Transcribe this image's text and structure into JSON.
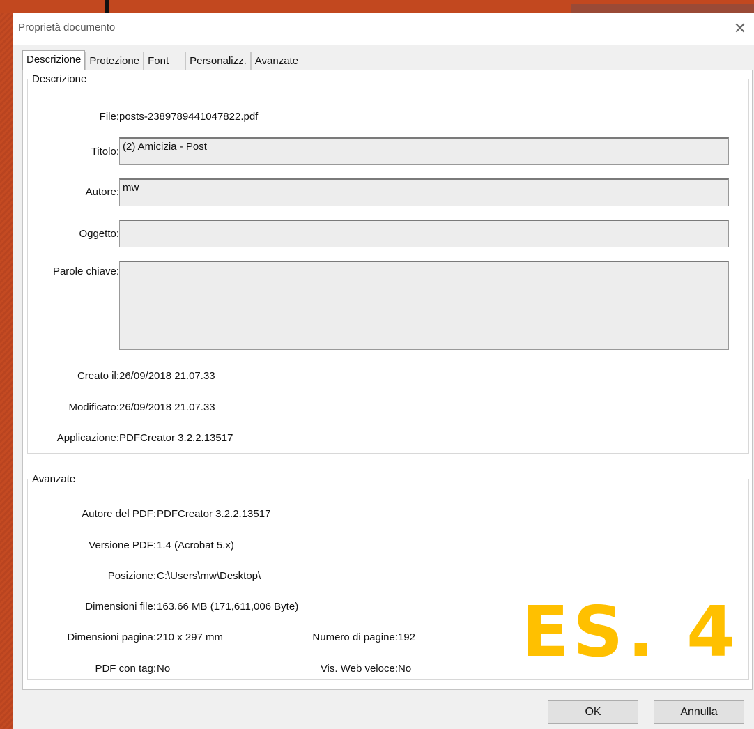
{
  "window": {
    "title": "Proprietà documento",
    "close_glyph": "✕"
  },
  "tabs": [
    {
      "label": "Descrizione"
    },
    {
      "label": "Protezione"
    },
    {
      "label": "Font"
    },
    {
      "label": "Personalizz."
    },
    {
      "label": "Avanzate"
    }
  ],
  "description": {
    "group_label": "Descrizione",
    "file_label": "File:",
    "file_value": "posts-2389789441047822.pdf",
    "title_label": "Titolo:",
    "title_value": "(2) Amicizia - Post",
    "author_label": "Autore:",
    "author_value": "mw",
    "subject_label": "Oggetto:",
    "subject_value": "",
    "keywords_label": "Parole chiave:",
    "keywords_value": "",
    "created_label": "Creato il:",
    "created_value": "26/09/2018 21.07.33",
    "modified_label": "Modificato:",
    "modified_value": "26/09/2018 21.07.33",
    "application_label": "Applicazione:",
    "application_value": "PDFCreator 3.2.2.13517"
  },
  "advanced": {
    "group_label": "Avanzate",
    "pdf_producer_label": "Autore del PDF:",
    "pdf_producer_value": "PDFCreator 3.2.2.13517",
    "pdf_version_label": "Versione PDF:",
    "pdf_version_value": "1.4 (Acrobat 5.x)",
    "location_label": "Posizione:",
    "location_value": "C:\\Users\\mw\\Desktop\\",
    "file_size_label": "Dimensioni file:",
    "file_size_value": "163.66 MB (171,611,006 Byte)",
    "page_size_label": "Dimensioni pagina:",
    "page_size_value": "210 x 297 mm",
    "page_count_label": "Numero di pagine:",
    "page_count_value": "192",
    "tagged_label": "PDF con tag:",
    "tagged_value": "No",
    "fast_web_label": "Vis. Web veloce:",
    "fast_web_value": "No"
  },
  "buttons": {
    "ok": "OK",
    "cancel": "Annulla"
  },
  "overlay": {
    "text": "ES. 4",
    "color": "#ffc000"
  }
}
